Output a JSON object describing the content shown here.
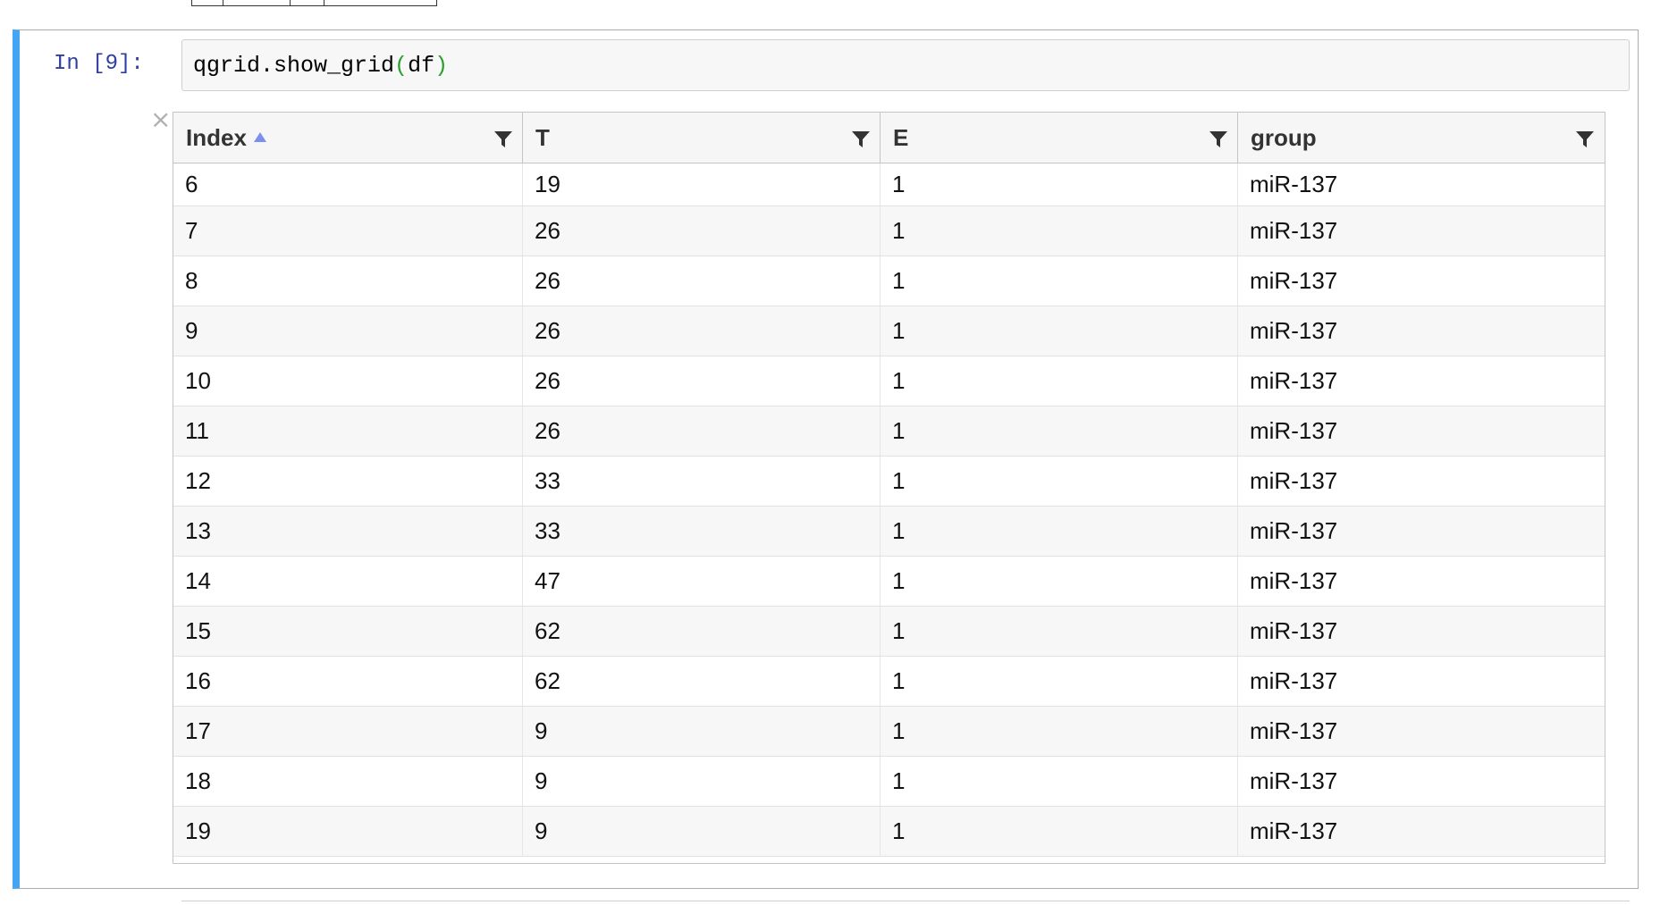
{
  "cell": {
    "prompt": "In [9]:",
    "code_pre": "qgrid.show_grid",
    "code_open": "(",
    "code_arg": "df",
    "code_close": ")"
  },
  "grid": {
    "close_label": "×",
    "columns": [
      {
        "label": "Index",
        "sorted": "asc"
      },
      {
        "label": "T"
      },
      {
        "label": "E"
      },
      {
        "label": "group"
      }
    ],
    "rows": [
      [
        "6",
        "19",
        "1",
        "miR-137"
      ],
      [
        "7",
        "26",
        "1",
        "miR-137"
      ],
      [
        "8",
        "26",
        "1",
        "miR-137"
      ],
      [
        "9",
        "26",
        "1",
        "miR-137"
      ],
      [
        "10",
        "26",
        "1",
        "miR-137"
      ],
      [
        "11",
        "26",
        "1",
        "miR-137"
      ],
      [
        "12",
        "33",
        "1",
        "miR-137"
      ],
      [
        "13",
        "33",
        "1",
        "miR-137"
      ],
      [
        "14",
        "47",
        "1",
        "miR-137"
      ],
      [
        "15",
        "62",
        "1",
        "miR-137"
      ],
      [
        "16",
        "62",
        "1",
        "miR-137"
      ],
      [
        "17",
        "9",
        "1",
        "miR-137"
      ],
      [
        "18",
        "9",
        "1",
        "miR-137"
      ],
      [
        "19",
        "9",
        "1",
        "miR-137"
      ]
    ]
  },
  "colors": {
    "cell_selected_bar": "#42a5f5",
    "prompt": "#303f9f",
    "paren": "#2ca02c",
    "sort_arrow": "#7b8ff0"
  }
}
